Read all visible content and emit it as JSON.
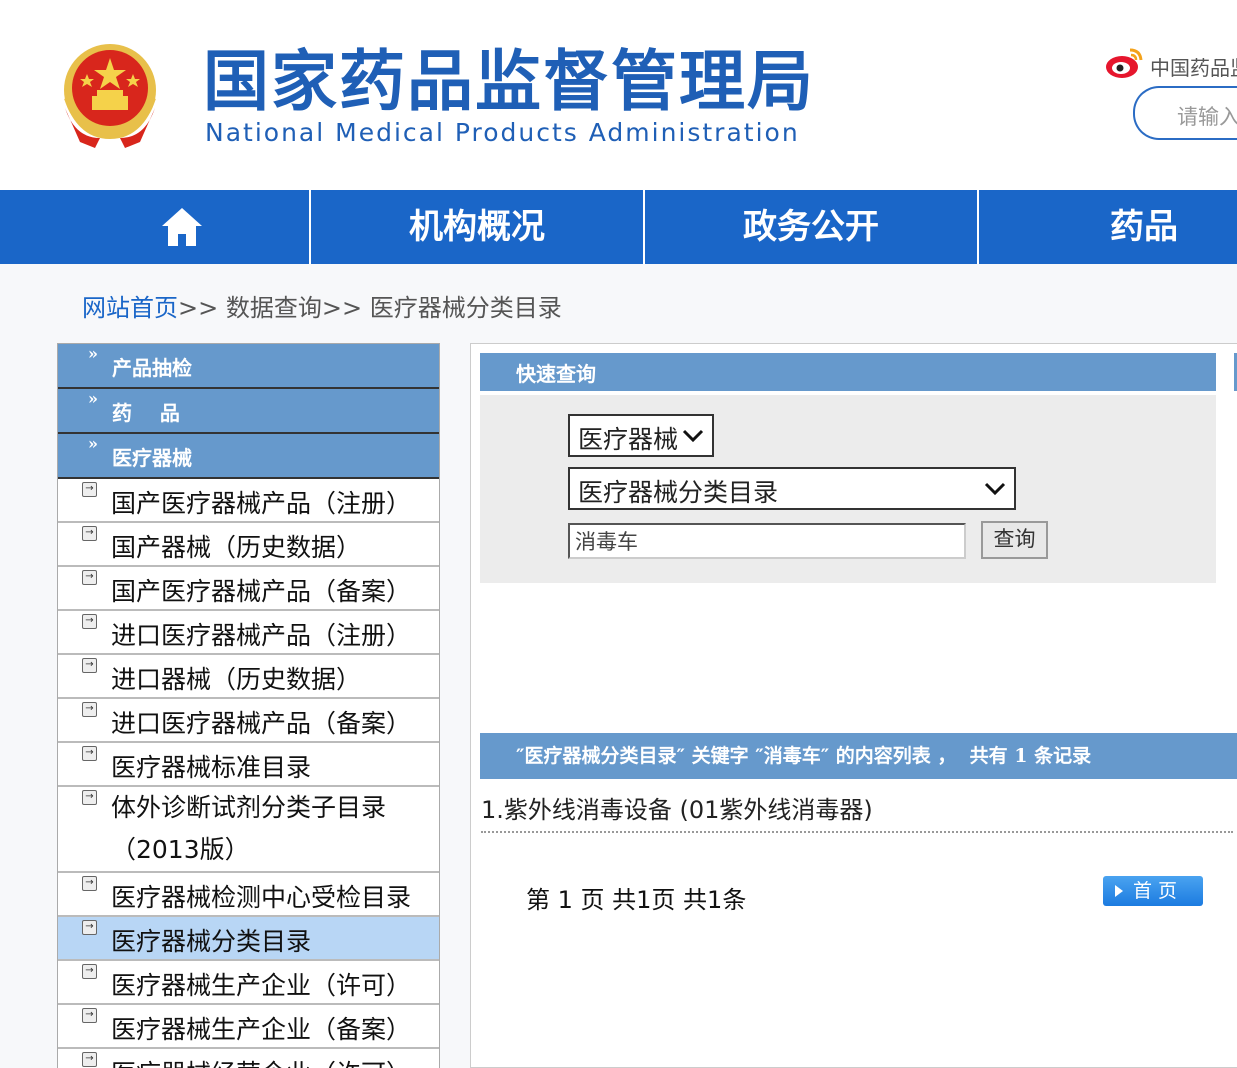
{
  "header": {
    "title_cn": "国家药品监督管理局",
    "title_en": "National Medical Products Administration",
    "weibo_text": "中国药品监",
    "search_placeholder": "请输入"
  },
  "nav": {
    "items": [
      {
        "label": "",
        "icon": "home-icon"
      },
      {
        "label": "机构概况"
      },
      {
        "label": "政务公开"
      },
      {
        "label": "药品"
      }
    ]
  },
  "breadcrumb": {
    "home": "网站首页",
    "sep1": ">>",
    "level2": "数据查询",
    "sep2": ">>",
    "current": "医疗器械分类目录"
  },
  "sidebar": {
    "heads": [
      {
        "label": "产品抽检"
      },
      {
        "label": "药    品"
      },
      {
        "label": "医疗器械"
      }
    ],
    "items": [
      {
        "label": "国产医疗器械产品（注册）"
      },
      {
        "label": "国产器械（历史数据）"
      },
      {
        "label": "国产医疗器械产品（备案）"
      },
      {
        "label": "进口医疗器械产品（注册）"
      },
      {
        "label": "进口器械（历史数据）"
      },
      {
        "label": "进口医疗器械产品（备案）"
      },
      {
        "label": "医疗器械标准目录"
      },
      {
        "label": "体外诊断试剂分类子目录（2013版）"
      },
      {
        "label": "医疗器械检测中心受检目录"
      },
      {
        "label": "医疗器械分类目录"
      },
      {
        "label": "医疗器械生产企业（许可）"
      },
      {
        "label": "医疗器械生产企业（备案）"
      },
      {
        "label": "医疗器械经营企业（许可）"
      }
    ]
  },
  "quick": {
    "title": "快速查询",
    "category_selected": "医疗器械",
    "catalog_selected": "医疗器械分类目录",
    "keyword_value": "消毒车",
    "query_button": "查询"
  },
  "results": {
    "header": "″医疗器械分类目录″ 关键字 ″消毒车″ 的内容列表 ，  共有 1 条记录",
    "items": [
      {
        "text": "1.紫外线消毒设备 (01紫外线消毒器)"
      }
    ],
    "pager_text": "第 1 页 共1页 共1条",
    "first_button": "首 页"
  },
  "colors": {
    "nav_blue": "#1a66c8",
    "panel_blue": "#6699cc",
    "title_blue": "#1f5fb6",
    "active_item": "#b8d6f5"
  }
}
